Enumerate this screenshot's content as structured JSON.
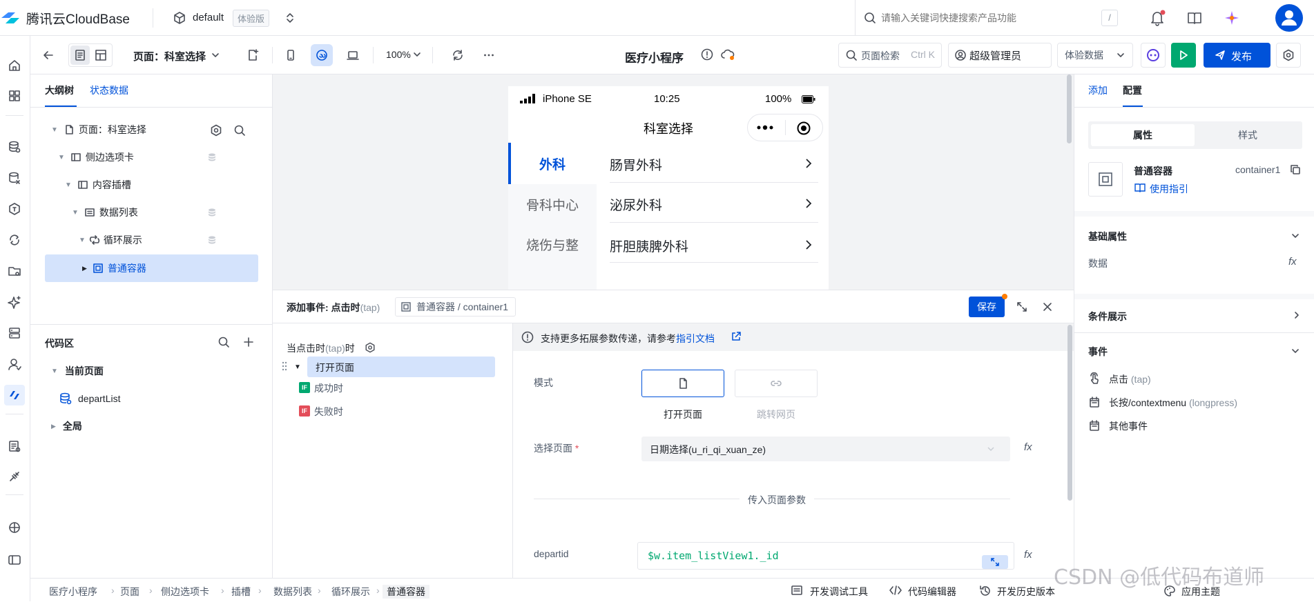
{
  "topbar": {
    "brand": "腾讯云CloudBase",
    "env": "default",
    "env_badge": "体验版",
    "search_placeholder": "请输入关键词快捷搜索产品功能",
    "search_shortcut": "/"
  },
  "toolbar": {
    "page_prefix": "页面：",
    "page_name": "科室选择",
    "zoom": "100%",
    "app_title": "医疗小程序",
    "page_search_label": "页面检索",
    "page_search_shortcut": "Ctrl K",
    "role_label": "超级管理员",
    "data_label": "体验数据",
    "publish_label": "发布"
  },
  "leftpanel": {
    "tabs": [
      "大纲树",
      "状态数据"
    ],
    "tree": [
      {
        "label": "页面：科室选择"
      },
      {
        "label": "侧边选项卡"
      },
      {
        "label": "内容插槽"
      },
      {
        "label": "数据列表"
      },
      {
        "label": "循环展示"
      },
      {
        "label": "普通容器"
      }
    ],
    "code_title": "代码区",
    "code_current": "当前页面",
    "code_item": "departList",
    "code_global": "全局"
  },
  "phone": {
    "carrier": "iPhone SE",
    "time": "10:25",
    "battery": "100%",
    "nav_title": "科室选择",
    "side_tabs": [
      "外科",
      "骨科中心",
      "烧伤与整"
    ],
    "list_items": [
      "肠胃外科",
      "泌尿外科",
      "肝胆胰脾外科"
    ]
  },
  "event": {
    "title": "添加事件: 点击时",
    "title_tap": "(tap)",
    "target": "普通容器 / container1",
    "save_label": "保存",
    "when_prefix": "当点击时",
    "when_tap": "(tap)",
    "when_suffix": "时",
    "action": "打开页面",
    "success": "成功时",
    "fail": "失败时",
    "if_badge": "IF",
    "notice": "支持更多拓展参数传递，请参考",
    "notice_link": "指引文档",
    "mode_label": "模式",
    "mode_open": "打开页面",
    "mode_web": "跳转网页",
    "select_page_label": "选择页面",
    "required_mark": "*",
    "select_page_value": "日期选择(u_ri_qi_xuan_ze)",
    "params_title": "传入页面参数",
    "param_name": "departid",
    "param_value": "$w.item_listView1._id"
  },
  "rightpanel": {
    "tabs": [
      "添加",
      "配置"
    ],
    "seg_tabs": [
      "属性",
      "样式"
    ],
    "comp_name": "普通容器",
    "comp_id": "container1",
    "guide_link": "使用指引",
    "basic_title": "基础属性",
    "data_label": "数据",
    "fx": "fx",
    "cond_title": "条件展示",
    "events_title": "事件",
    "ev_click": "点击",
    "ev_click_tap": "(tap)",
    "ev_long": "长按/contextmenu",
    "ev_long_tag": "(longpress)",
    "ev_other": "其他事件"
  },
  "statusbar": {
    "crumbs": [
      "医疗小程序",
      "页面",
      "侧边选项卡",
      "插槽",
      "数据列表",
      "循环展示",
      "普通容器"
    ],
    "debug_tool": "开发调试工具",
    "code_editor": "代码编辑器",
    "history": "开发历史版本",
    "theme": "应用主题",
    "watermark": "CSDN @低代码布道师"
  },
  "colors": {
    "accent": "#0052d9",
    "run": "#00a870",
    "selected_bg": "#d4e3fc",
    "fail": "#e34d59",
    "success": "#00a870"
  }
}
